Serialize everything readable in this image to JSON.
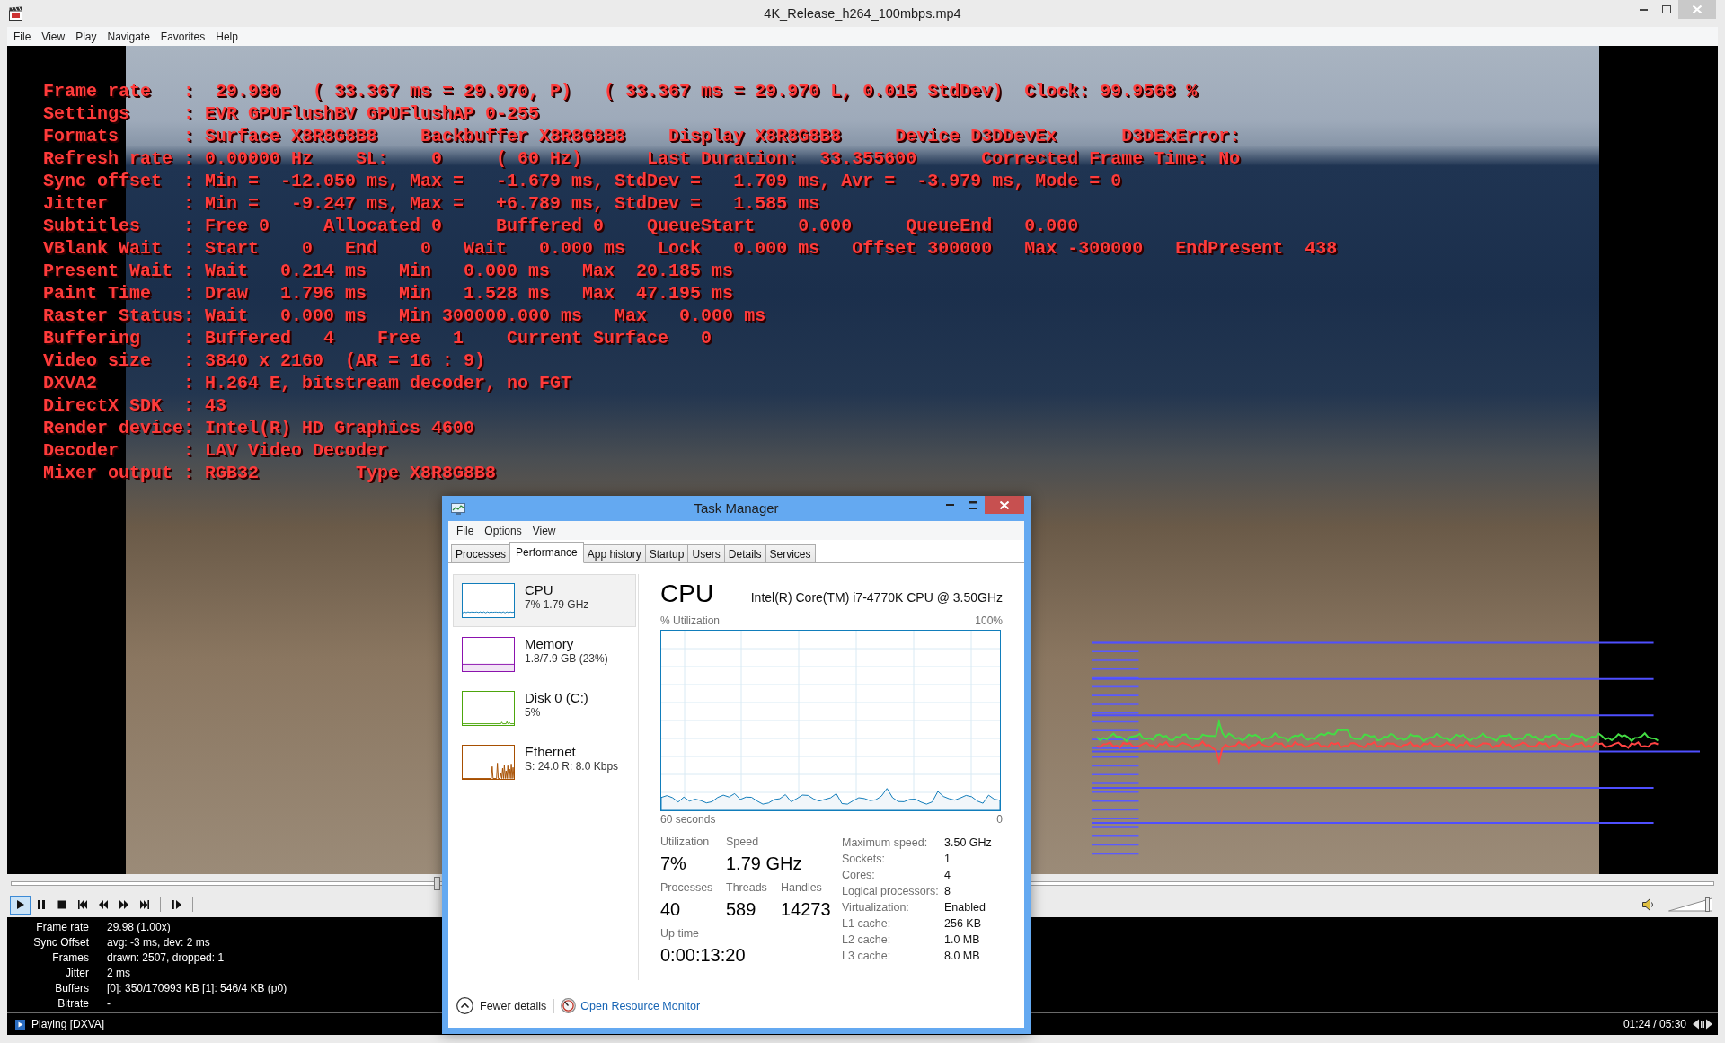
{
  "player": {
    "title": "4K_Release_h264_100mbps.mp4",
    "menu": [
      "File",
      "View",
      "Play",
      "Navigate",
      "Favorites",
      "Help"
    ],
    "osd_lines": [
      "Frame rate   :  29.980   ( 33.367 ms = 29.970, P)   ( 33.367 ms = 29.970 L, 0.015 StdDev)  Clock: 99.9568 %",
      "Settings     : EVR GPUFlushBV GPUFlushAP 0-255",
      "Formats      : Surface X8R8G8B8    Backbuffer X8R8G8B8    Display X8R8G8B8     Device D3DDevEx      D3DExError:",
      "Refresh rate : 0.00000 Hz    SL:    0     ( 60 Hz)      Last Duration:  33.355600      Corrected Frame Time: No",
      "Sync offset  : Min =  -12.050 ms, Max =   -1.679 ms, StdDev =   1.709 ms, Avr =  -3.979 ms, Mode = 0",
      "Jitter       : Min =   -9.247 ms, Max =   +6.789 ms, StdDev =   1.585 ms",
      "Subtitles    : Free 0     Allocated 0     Buffered 0    QueueStart    0.000     QueueEnd   0.000",
      "VBlank Wait  : Start    0   End    0   Wait   0.000 ms   Lock   0.000 ms   Offset 300000   Max -300000   EndPresent  438",
      "Present Wait : Wait   0.214 ms   Min   0.000 ms   Max  20.185 ms",
      "Paint Time   : Draw   1.796 ms   Min   1.528 ms   Max  47.195 ms",
      "Raster Status: Wait   0.000 ms   Min 300000.000 ms   Max   0.000 ms",
      "Buffering    : Buffered   4    Free   1    Current Surface   0",
      "Video size   : 3840 x 2160  (AR = 16 : 9)",
      "DXVA2        : H.264 E, bitstream decoder, no FGT",
      "DirectX SDK  : 43",
      "Render device: Intel(R) HD Graphics 4600",
      "Decoder      : LAV Video Decoder",
      "Mixer output : RGB32         Type X8R8G8B8"
    ],
    "seek": {
      "level": 0.25
    },
    "controls": [
      {
        "kind": "play",
        "pressed": true
      },
      {
        "kind": "pause",
        "pressed": false
      },
      {
        "kind": "stop",
        "pressed": false
      },
      {
        "kind": "previous",
        "pressed": false
      },
      {
        "kind": "rewind",
        "pressed": false
      },
      {
        "kind": "forward",
        "pressed": false
      },
      {
        "kind": "next",
        "pressed": false
      },
      {
        "kind": "frame_step",
        "pressed": false
      }
    ],
    "volume": {
      "level": 0.9
    },
    "stats": [
      {
        "label": "Frame rate",
        "value": "29.98 (1.00x)"
      },
      {
        "label": "Sync Offset",
        "value": "avg: -3 ms, dev: 2 ms"
      },
      {
        "label": "Frames",
        "value": "drawn: 2507, dropped: 1"
      },
      {
        "label": "Jitter",
        "value": "2 ms"
      },
      {
        "label": "Buffers",
        "value": "[0]: 350/170993 KB [1]: 546/4 KB (p0)"
      },
      {
        "label": "Bitrate",
        "value": "-"
      }
    ],
    "status": {
      "state": "Playing [DXVA]",
      "time": "01:24 / 05:30"
    }
  },
  "task_manager": {
    "title": "Task Manager",
    "menu": [
      "File",
      "Options",
      "View"
    ],
    "tabs": [
      {
        "label": "Processes",
        "selected": false
      },
      {
        "label": "Performance",
        "selected": true
      },
      {
        "label": "App history",
        "selected": false
      },
      {
        "label": "Startup",
        "selected": false
      },
      {
        "label": "Users",
        "selected": false
      },
      {
        "label": "Details",
        "selected": false
      },
      {
        "label": "Services",
        "selected": false
      }
    ],
    "resources": [
      {
        "kind": "cpu",
        "name": "CPU",
        "detail": "7% 1.79 GHz",
        "color": "#117dbb",
        "selected": true
      },
      {
        "kind": "memory",
        "name": "Memory",
        "detail": "1.8/7.9 GB (23%)",
        "color": "#8b12ae",
        "selected": false
      },
      {
        "kind": "disk",
        "name": "Disk 0 (C:)",
        "detail": "5%",
        "color": "#4da60c",
        "selected": false
      },
      {
        "kind": "ethernet",
        "name": "Ethernet",
        "detail": "S: 24.0 R: 8.0 Kbps",
        "color": "#a74f01",
        "selected": false
      }
    ],
    "heading": "CPU",
    "processor": "Intel(R) Core(TM) i7-4770K CPU @ 3.50GHz",
    "graph_labels": {
      "title": "% Utilization",
      "max": "100%",
      "span": "60 seconds",
      "end": "0"
    },
    "metrics": [
      [
        {
          "label": "Utilization",
          "value": "7%"
        },
        {
          "label": "Speed",
          "value": "1.79 GHz"
        }
      ],
      [
        {
          "label": "Processes",
          "value": "40"
        },
        {
          "label": "Threads",
          "value": "589"
        },
        {
          "label": "Handles",
          "value": "14273"
        }
      ],
      [
        {
          "label": "Up time",
          "value": "0:00:13:20"
        }
      ]
    ],
    "specs": [
      {
        "label": "Maximum speed:",
        "value": "3.50 GHz"
      },
      {
        "label": "Sockets:",
        "value": "1"
      },
      {
        "label": "Cores:",
        "value": "4"
      },
      {
        "label": "Logical processors:",
        "value": "8"
      },
      {
        "label": "Virtualization:",
        "value": "Enabled"
      },
      {
        "label": "L1 cache:",
        "value": "256 KB"
      },
      {
        "label": "L2 cache:",
        "value": "1.0 MB"
      },
      {
        "label": "L3 cache:",
        "value": "8.0 MB"
      }
    ],
    "footer": {
      "fewer_details": "Fewer details",
      "link": "Open Resource Monitor"
    }
  }
}
